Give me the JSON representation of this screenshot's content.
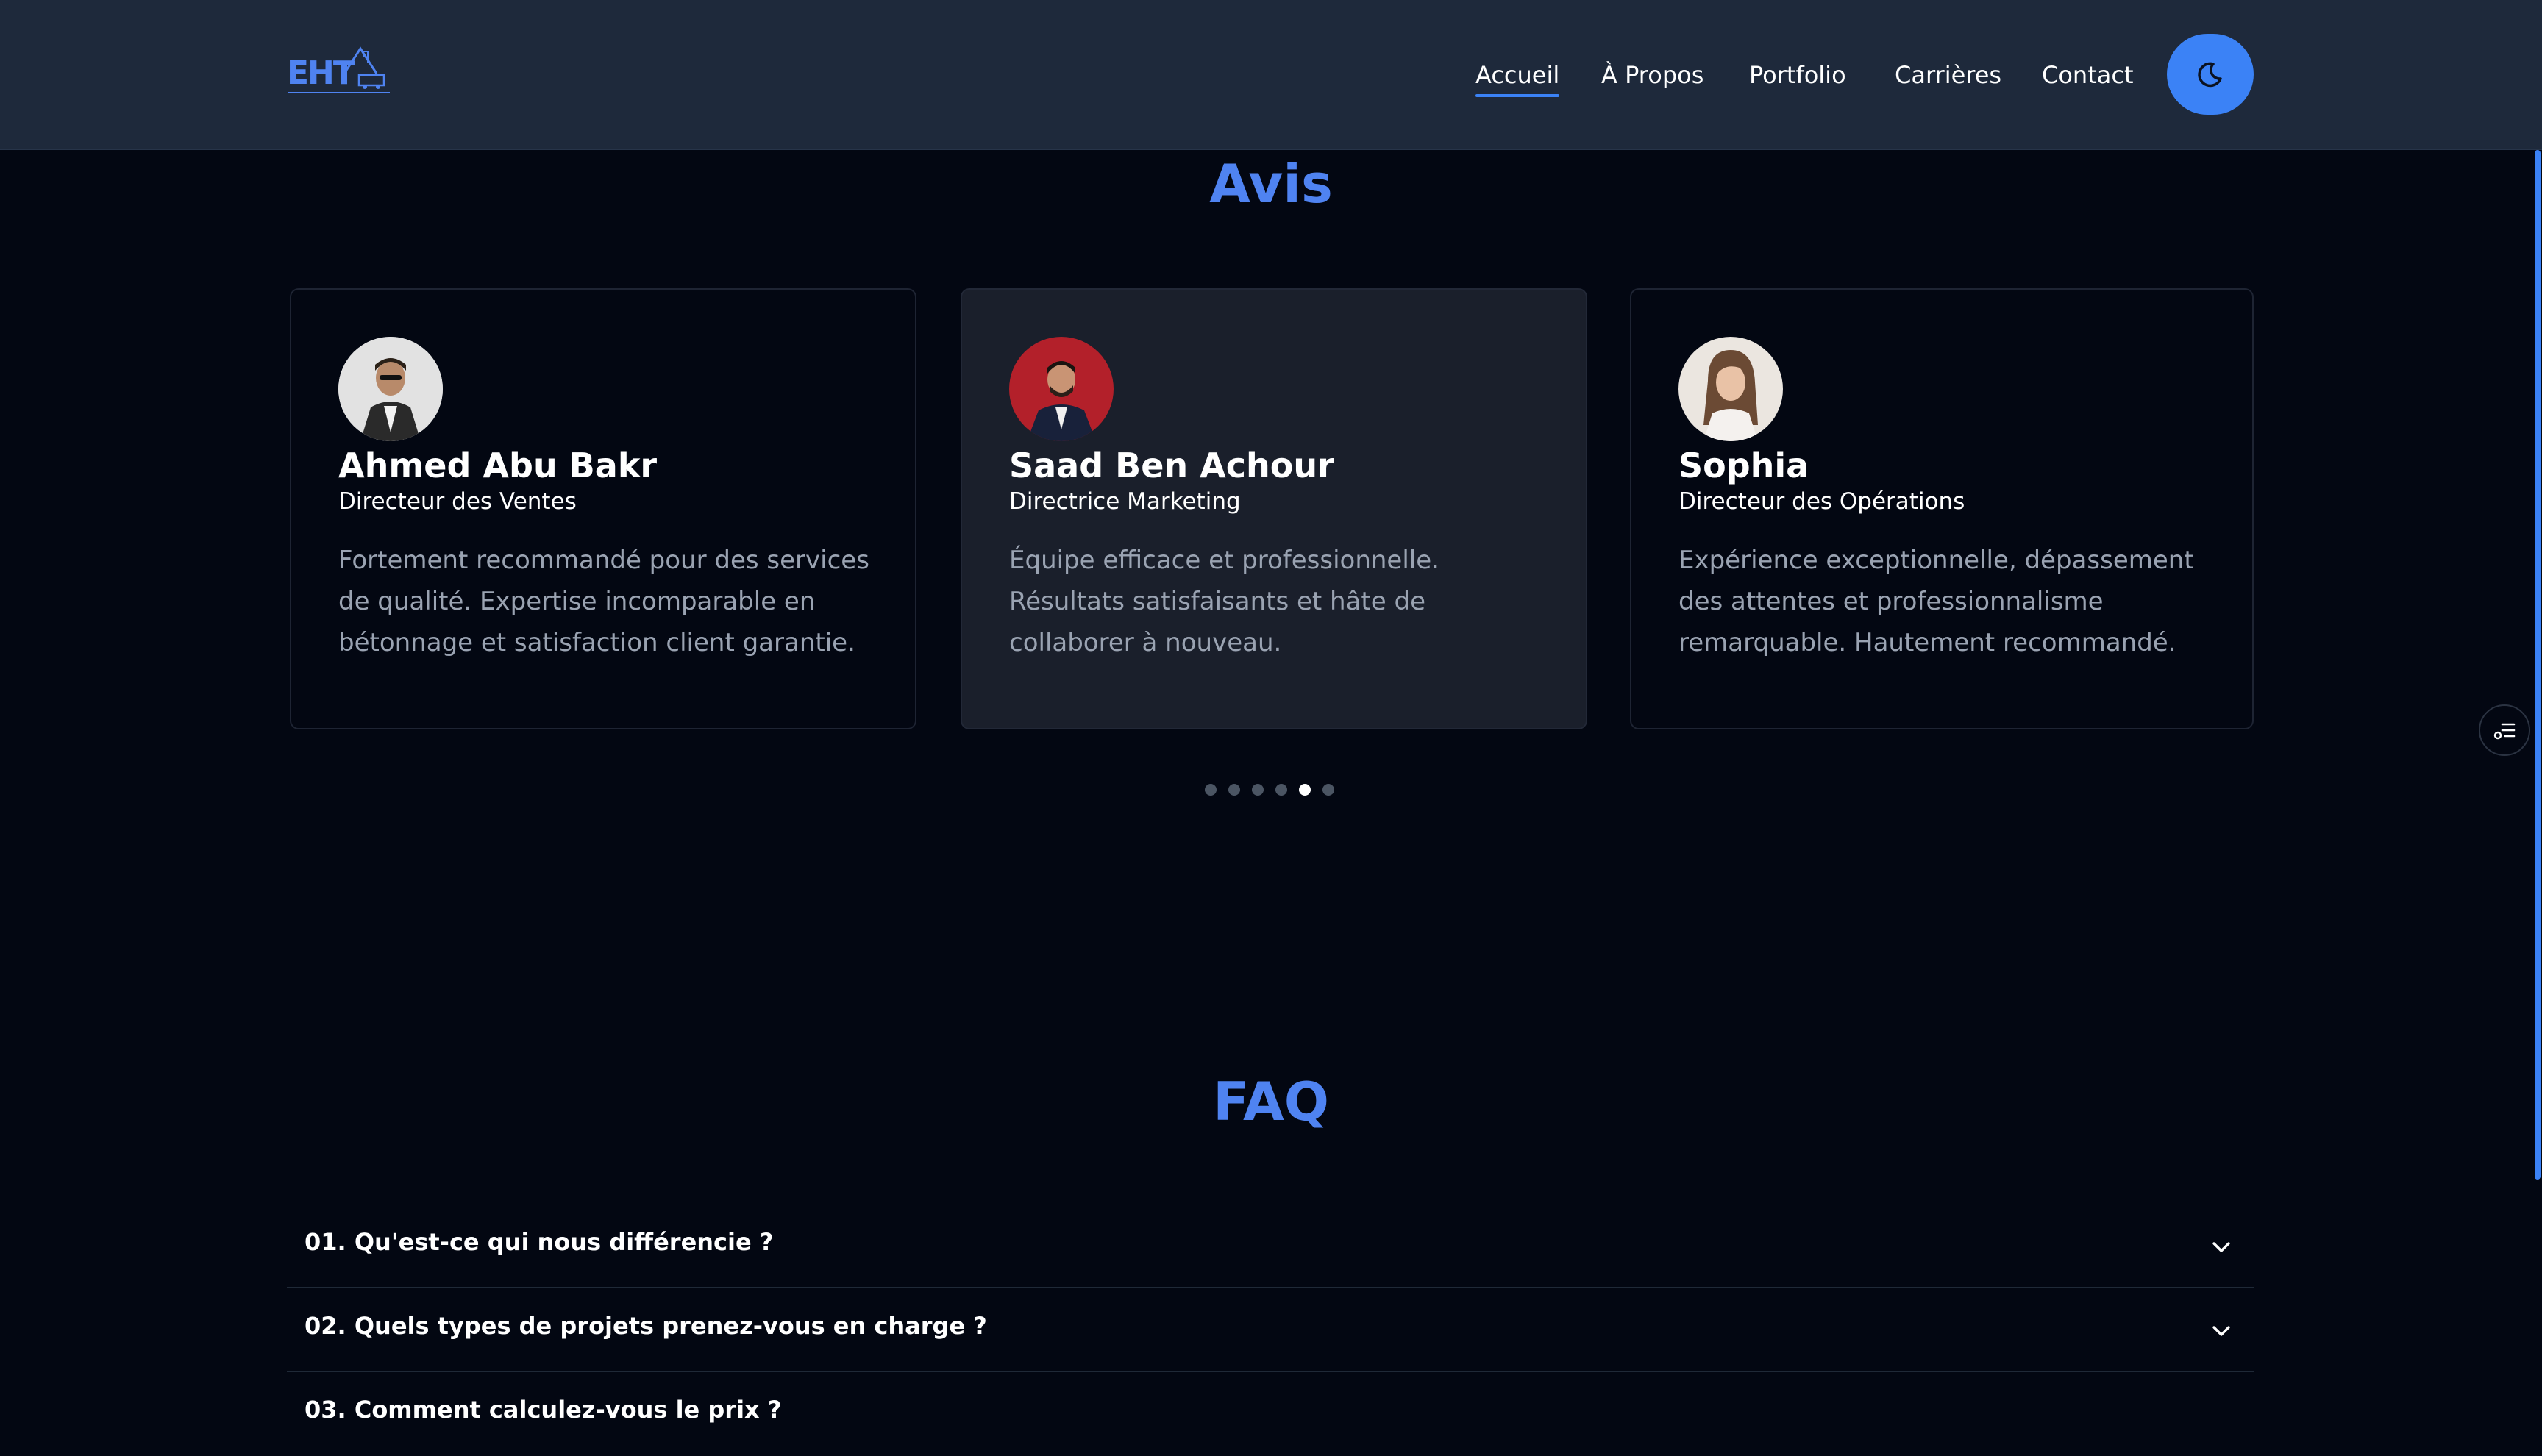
{
  "header": {
    "logo_text": "EHT",
    "nav": [
      {
        "label": "Accueil",
        "active": true
      },
      {
        "label": "À Propos",
        "active": false
      },
      {
        "label": "Portfolio",
        "active": false
      },
      {
        "label": "Carrières",
        "active": false
      },
      {
        "label": "Contact",
        "active": false
      }
    ],
    "theme_toggle_icon": "moon-icon"
  },
  "reviews": {
    "title": "Avis",
    "items": [
      {
        "name": "Ahmed Abu Bakr",
        "role": "Directeur des Ventes",
        "quote": "Fortement recommandé pour des services de qualité. Expertise incomparable en bétonnage et satisfaction client garantie.",
        "avatar_bg": "#d8d8d8"
      },
      {
        "name": "Saad Ben Achour",
        "role": "Directrice Marketing",
        "quote": "Équipe efficace et professionnelle. Résultats satisfaisants et hâte de collaborer à nouveau.",
        "avatar_bg": "#b3202a"
      },
      {
        "name": "Sophia",
        "role": "Directeur des Opérations",
        "quote": "Expérience exceptionnelle, dépassement des attentes et professionnalisme remarquable. Hautement recommandé.",
        "avatar_bg": "#ece7e2"
      }
    ],
    "pagination": {
      "count": 6,
      "active_index": 4
    }
  },
  "faq": {
    "title": "FAQ",
    "items": [
      {
        "question": "01. Qu'est-ce qui nous différencie ?"
      },
      {
        "question": "02. Quels types de projets prenez-vous en charge ?"
      },
      {
        "question": "03. Comment calculez-vous le prix ?"
      }
    ]
  },
  "colors": {
    "accent": "#3b82f6",
    "title": "#4f83f1",
    "background": "#030712",
    "header_bg": "#1e293b"
  }
}
